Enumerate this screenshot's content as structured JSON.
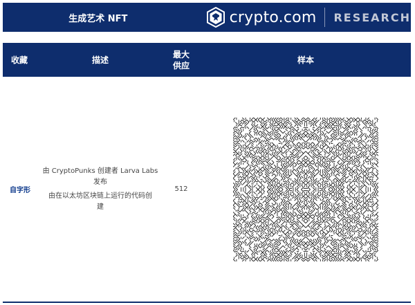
{
  "header": {
    "title": "生成艺术 NFT",
    "brand_name": "crypto.com",
    "brand_sub": "RESEARCH"
  },
  "table": {
    "headers": {
      "collection": "收藏",
      "description": "描述",
      "supply_line1": "最大",
      "supply_line2": "供应",
      "sample": "样本"
    },
    "rows": [
      {
        "collection": "自字形",
        "description_lines": [
          "由 CryptoPunks 创建者 Larva Labs",
          "发布",
          "由在以太坊区块链上运行的代码创",
          "建"
        ],
        "supply": "512"
      }
    ]
  },
  "colors": {
    "navy": "#0e2d6d",
    "link": "#0e3a8c"
  },
  "icons": {
    "brand": "crypto-lion-shield-icon",
    "sample": "autoglyph-pattern"
  }
}
